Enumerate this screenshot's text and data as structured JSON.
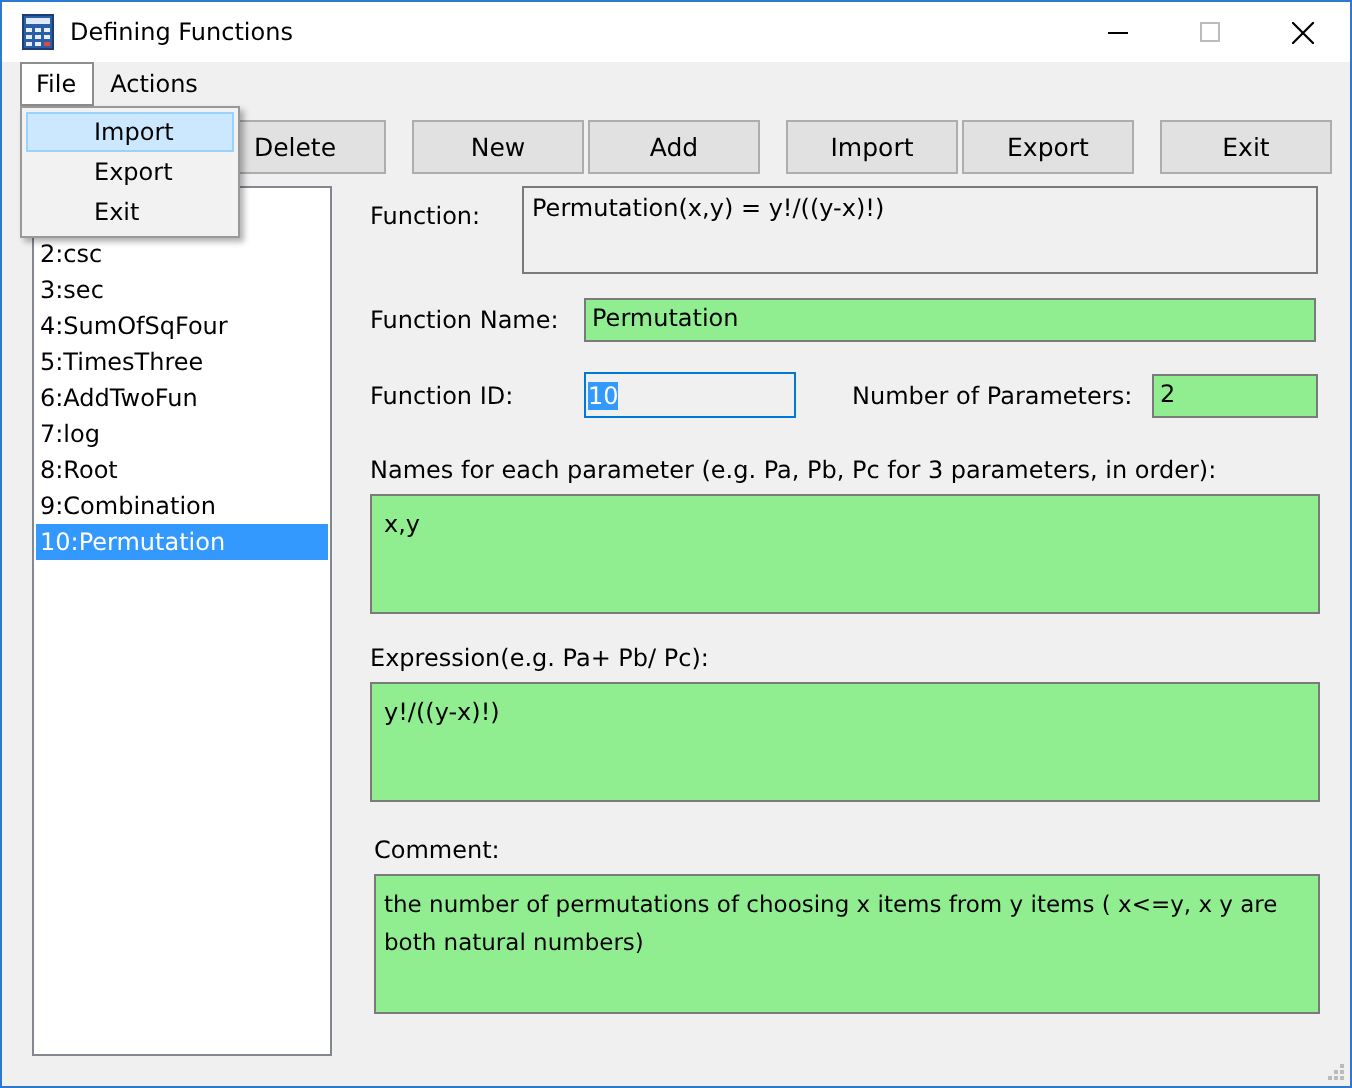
{
  "window": {
    "title": "Defining Functions"
  },
  "menu": [
    {
      "label": "File",
      "selected": true
    },
    {
      "label": "Actions",
      "selected": false
    }
  ],
  "dropdown": [
    {
      "label": "Import",
      "selected": true
    },
    {
      "label": "Export",
      "selected": false
    },
    {
      "label": "Exit",
      "selected": false
    }
  ],
  "toolbar": [
    {
      "label": "Delete",
      "kind": "partial"
    },
    {
      "label": "New",
      "kind": "gap"
    },
    {
      "label": "Add",
      "kind": "plain"
    },
    {
      "label": "Import",
      "kind": "gap"
    },
    {
      "label": "Export",
      "kind": "plain"
    },
    {
      "label": "Exit",
      "kind": "gap"
    }
  ],
  "function_list": [
    {
      "label": "2:csc",
      "selected": false
    },
    {
      "label": "3:sec",
      "selected": false
    },
    {
      "label": "4:SumOfSqFour",
      "selected": false
    },
    {
      "label": "5:TimesThree",
      "selected": false
    },
    {
      "label": "6:AddTwoFun",
      "selected": false
    },
    {
      "label": "7:log",
      "selected": false
    },
    {
      "label": "8:Root",
      "selected": false
    },
    {
      "label": "9:Combination",
      "selected": false
    },
    {
      "label": "10:Permutation",
      "selected": true
    }
  ],
  "form": {
    "function_label": "Function:",
    "function_value": "Permutation(x,y) = y!/((y-x)!)",
    "name_label": "Function Name:",
    "name_value": "Permutation",
    "id_label": "Function ID:",
    "id_value": "10",
    "params_count_label": "Number of Parameters:",
    "params_count_value": "2",
    "param_names_label": "Names for each parameter (e.g. Pa, Pb, Pc for 3 parameters, in order):",
    "param_names_value": "x,y",
    "expression_label": "Expression(e.g. Pa+ Pb/ Pc):",
    "expression_value": "y!/((y-x)!)",
    "comment_label": "Comment:",
    "comment_value": "the number of permutations of choosing x items from y items ( x<=y, x y are both natural numbers)"
  }
}
